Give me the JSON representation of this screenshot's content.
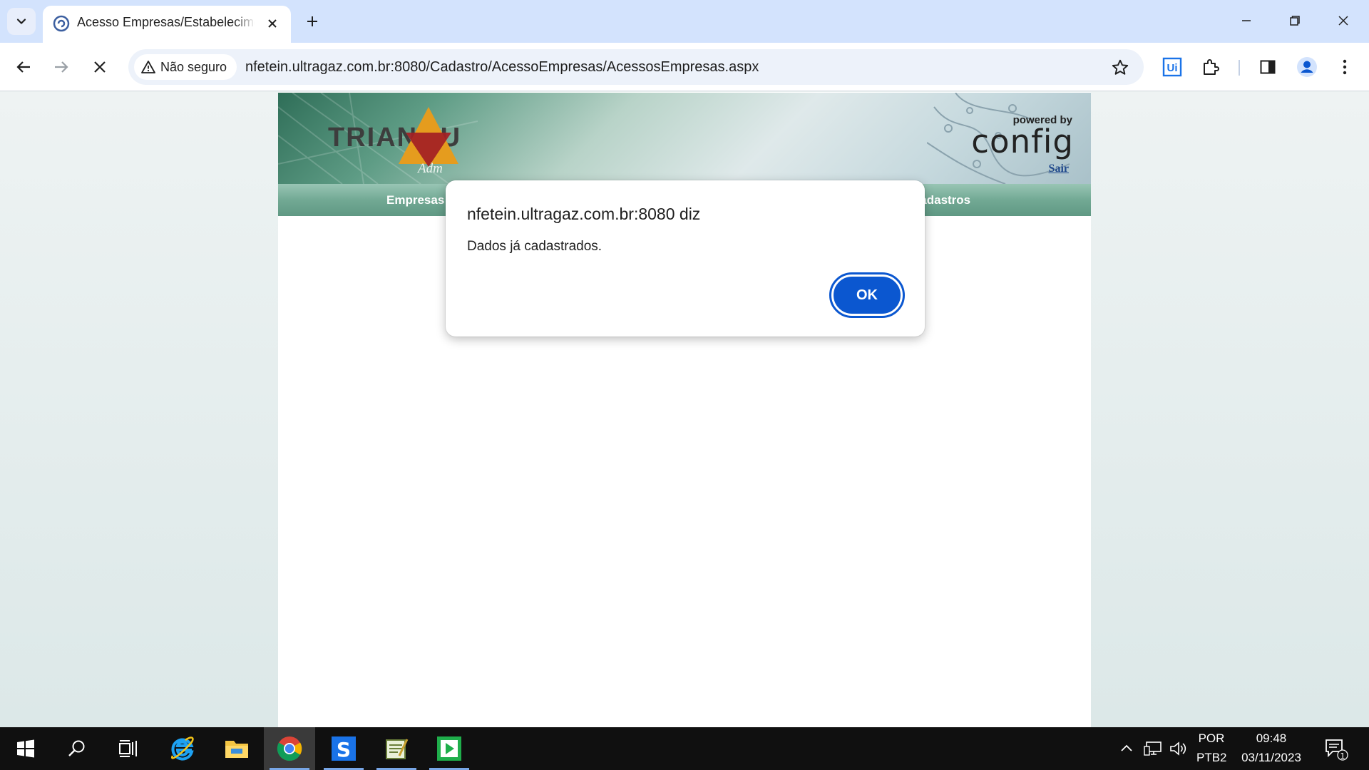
{
  "browser": {
    "tab": {
      "title": "Acesso Empresas/Estabelecimentos"
    },
    "security_label": "Não seguro",
    "url": "nfetein.ultragaz.com.br:8080/Cadastro/AcessoEmpresas/AcessosEmpresas.aspx",
    "extension_label": "Ui"
  },
  "page": {
    "logo_text": "TRIANGU",
    "logo_subtext": "Adm",
    "powered_by": "powered by",
    "brand": "config",
    "logout_link": "Sair",
    "menu": [
      "Empresas",
      "Cadastros"
    ],
    "colors": {
      "menu": "#72a994",
      "banner": "#5e9c85"
    }
  },
  "dialog": {
    "title": "nfetein.ultragaz.com.br:8080 diz",
    "message": "Dados já cadastrados.",
    "ok_label": "OK",
    "accent": "#0b57d0"
  },
  "taskbar": {
    "apps": [
      "windows-start-icon",
      "search-icon",
      "task-view-icon",
      "internet-explorer-icon",
      "file-explorer-icon",
      "chrome-icon",
      "app-blue-s-icon",
      "notepad-app-icon",
      "green-play-app-icon"
    ],
    "language_top": "POR",
    "language_bottom": "PTB2",
    "time": "09:48",
    "date": "03/11/2023",
    "notification_count": "1"
  }
}
